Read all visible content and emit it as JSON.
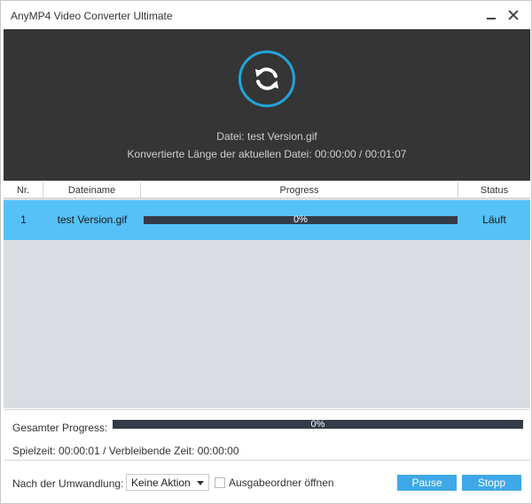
{
  "window": {
    "title": "AnyMP4 Video Converter Ultimate",
    "controls": [
      "minimize-icon",
      "close-icon"
    ]
  },
  "header": {
    "icon": "refresh-icon",
    "icon_color": "#22a4db",
    "file_line": "Datei: test Version.gif",
    "length_line": "Konvertierte Länge der aktuellen Datei: 00:00:00 / 00:01:07"
  },
  "table": {
    "columns": [
      "Nr.",
      "Dateiname",
      "Progress",
      "Status"
    ],
    "rows": [
      {
        "nr": "1",
        "filename": "test Version.gif",
        "progress_text": "0%",
        "progress": 0,
        "status": "Läuft"
      }
    ]
  },
  "summary": {
    "total_label": "Gesamter Progress:",
    "total_progress_text": "0%",
    "total_progress": 0,
    "time_line": "Spielzeit: 00:00:01 / Verbleibende Zeit: 00:00:00"
  },
  "footer": {
    "after_label": "Nach der Umwandlung:",
    "after_select": "Keine Aktion",
    "open_folder_label": "Ausgabeordner öffnen",
    "open_folder_checked": false,
    "pause_label": "Pause",
    "stop_label": "Stopp"
  },
  "colors": {
    "accent": "#22a4db",
    "selected_row": "#55c1f7",
    "header_bg": "#353535",
    "button": "#3ea8e8"
  }
}
